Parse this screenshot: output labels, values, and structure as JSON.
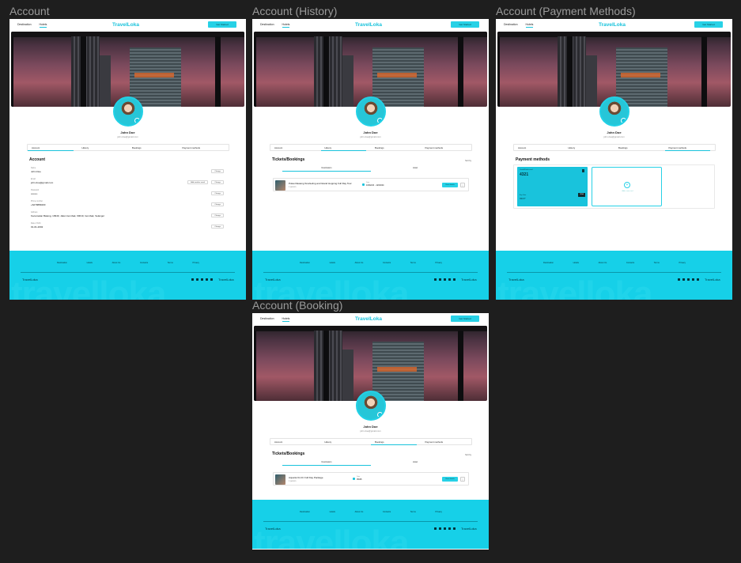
{
  "frames": [
    {
      "title": "Account"
    },
    {
      "title": "Account (History)"
    },
    {
      "title": "Account (Payment Methods)"
    },
    {
      "title": "Account (Booking)"
    }
  ],
  "nav": {
    "links": [
      "Destination",
      "Hotels"
    ],
    "logo": "TravelLoka",
    "cta": "Get Started"
  },
  "profile": {
    "name": "John Doe",
    "email": "john.doe@gmail.com"
  },
  "tabs": [
    "Account",
    "History",
    "Bookings",
    "Payment methods"
  ],
  "account": {
    "title": "Account",
    "fields": [
      {
        "label": "Name",
        "value": "John Doe",
        "button": "Change"
      },
      {
        "label": "Email",
        "value": "john.doe@gmail.com",
        "add": "Add another email",
        "button": "Change"
      },
      {
        "label": "Password",
        "value": "••••••••",
        "button": "Change"
      },
      {
        "label": "Phone number",
        "value": "+6279889400",
        "button": "Change"
      },
      {
        "label": "Address",
        "value": "Kecamatan Batang, 19940, Jalan Gombak, 60010, Gombak, Selangor",
        "button": "Change"
      },
      {
        "label": "Date of birth",
        "value": "01-01-2002",
        "button": "Change"
      }
    ]
  },
  "history": {
    "title": "Tickets/Bookings",
    "sort": "Sort by",
    "subtabs": [
      "Destination",
      "Hotel"
    ],
    "item": {
      "title": "Pulau Rawang Snorkeling and Island Hopping Full Day Tour",
      "sub": "1 person",
      "date_label": "Date",
      "date": "10/02/24 - 12/02/24",
      "button": "View details",
      "more": "⋮"
    }
  },
  "payment": {
    "title": "Payment methods",
    "card_label": "Credit/Debit card",
    "card_num": "4321",
    "exp_label": "Exp Date",
    "exp": "02/27",
    "brand": "VISA",
    "add_text": "Add a new card"
  },
  "booking": {
    "title": "Tickets/Bookings",
    "sort": "Sort by",
    "subtabs": [
      "Destination",
      "Hotel"
    ],
    "item": {
      "title": "Aquaria KLCC Full Day Package",
      "sub": "1 person",
      "date_label": "Date",
      "date": "05/25",
      "button": "View details",
      "more": "⋮"
    }
  },
  "footer": {
    "links": [
      "Destination",
      "Hotels",
      "About Us",
      "Contacts",
      "Terms",
      "Privacy"
    ],
    "brand": "TravelLoka",
    "brand2": "TravelLoka",
    "watermark": "travelloka"
  }
}
